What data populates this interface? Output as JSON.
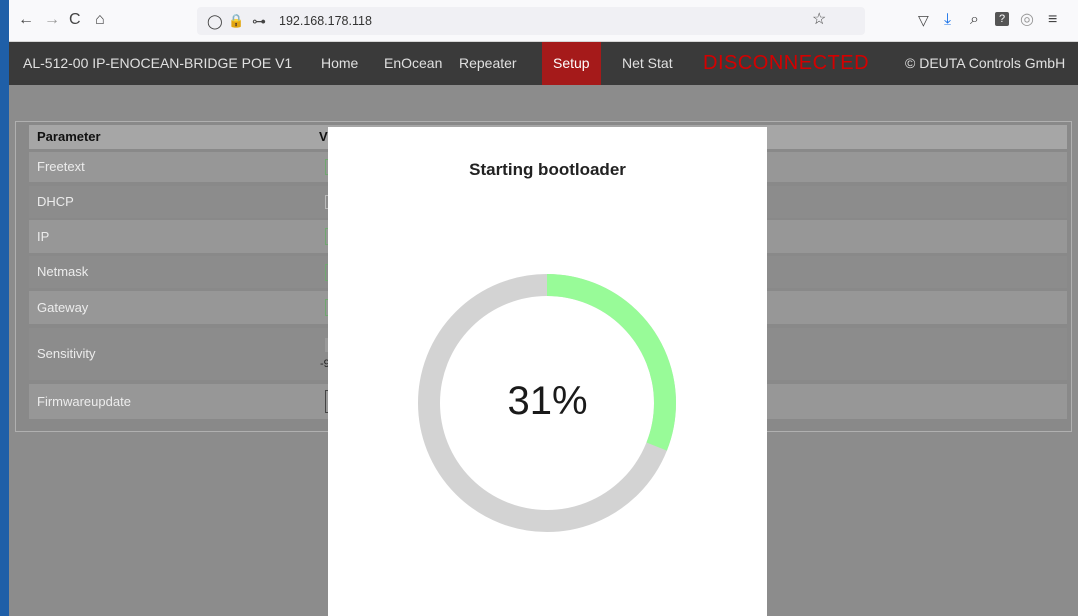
{
  "browser": {
    "back_glyph": "←",
    "forward_glyph": "→",
    "reload_glyph": "C",
    "home_glyph": "⌂",
    "shield_glyph": "◯",
    "lock_glyph": "🔒",
    "key_glyph": "⊶",
    "url": "192.168.178.118",
    "star_glyph": "☆",
    "pocket_glyph": "▽",
    "download_glyph": "⤓",
    "zoom_glyph": "⌕",
    "ext_glyph": "?",
    "account_glyph": "◎",
    "menu_glyph": "≡"
  },
  "header": {
    "device": "AL-512-00 IP-ENOCEAN-BRIDGE POE V1",
    "nav": [
      "Home",
      "EnOcean",
      "Repeater",
      "Setup",
      "Net Stat"
    ],
    "active_nav": "Setup",
    "status": "DISCONNECTED",
    "copyright": "© DEUTA Controls GmbH"
  },
  "table": {
    "header_param": "Parameter",
    "header_value_partial": "V",
    "rows": [
      "Freetext",
      "DHCP",
      "IP",
      "Netmask",
      "Gateway",
      "Sensitivity",
      "Firmwareupdate"
    ],
    "sensitivity_partial": "-9"
  },
  "overlay": {
    "title": "Starting bootloader",
    "percent_text": "31%",
    "progress": 0.31
  },
  "colors": {
    "progress": "#98fb98",
    "track": "#d3d3d3",
    "header_bg": "#3a3a3a",
    "active_nav": "#a51a1a",
    "status": "#d40000"
  }
}
